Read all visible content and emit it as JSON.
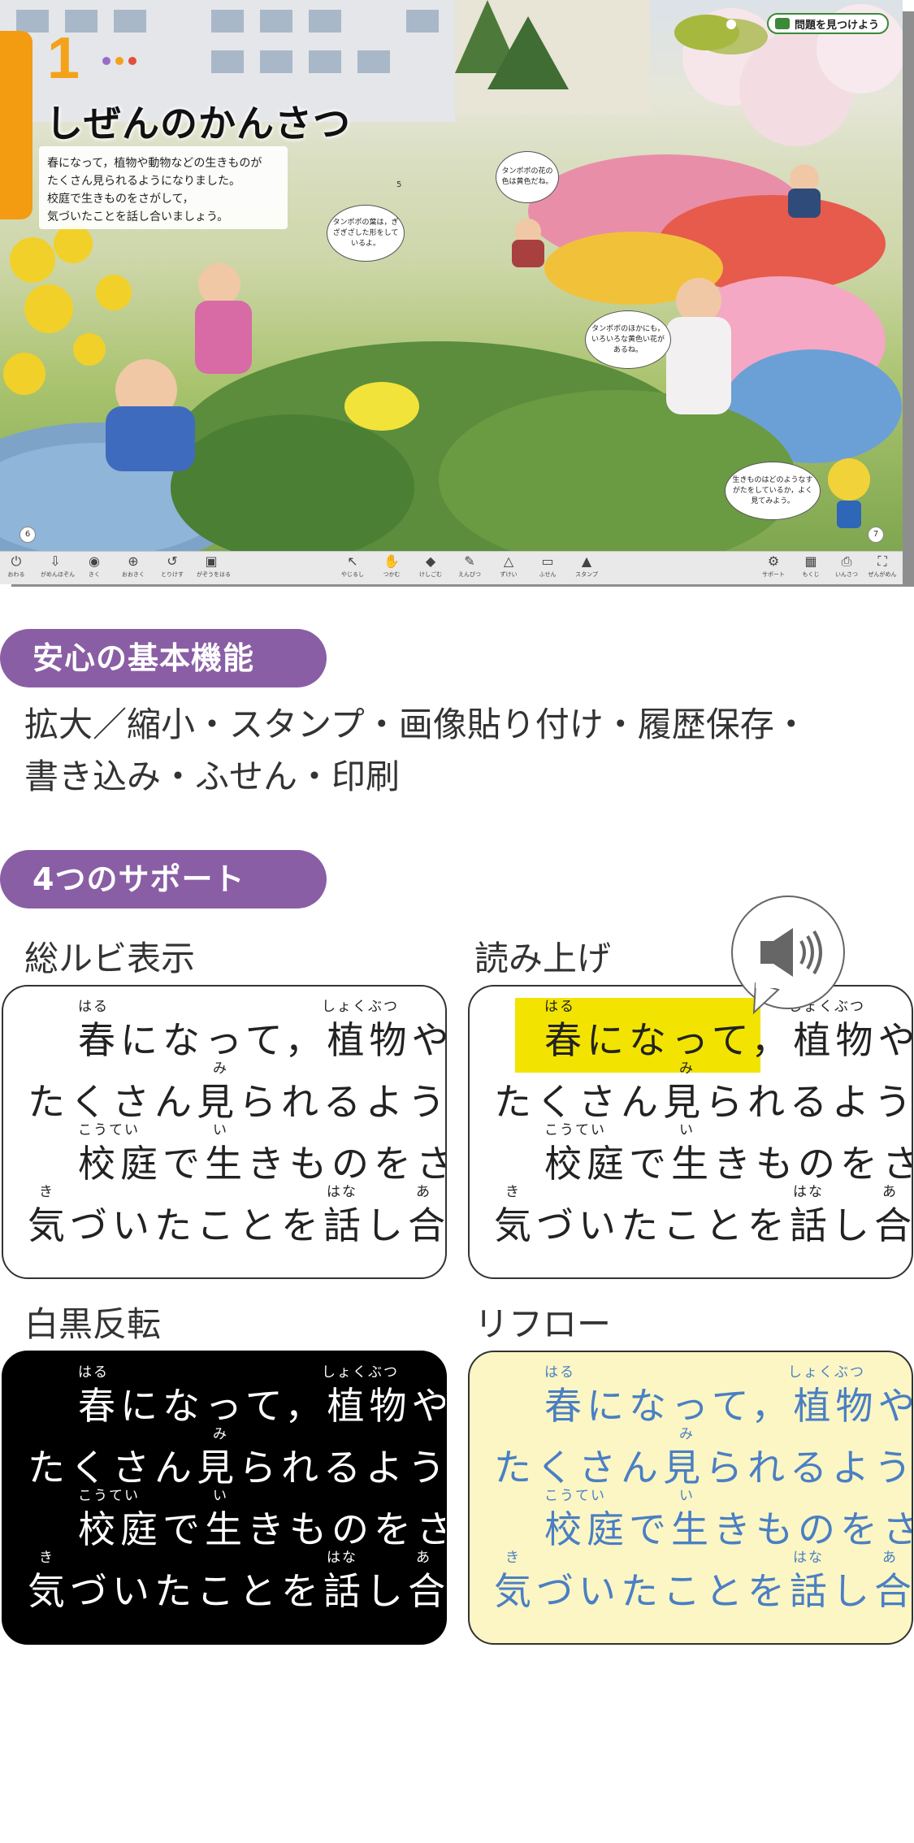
{
  "viewer": {
    "lesson_number": "1",
    "lesson_title": "しぜんのかんさつ",
    "intro_lines": [
      "春になって，植物や動物などの生きものが",
      "たくさん見られるようになりました。",
      "校庭で生きものをさがして，",
      "気づいたことを話し合いましょう。"
    ],
    "problem_badge": "問題を見つけよう",
    "bubbles": [
      "タンポポの葉は，ぎざぎざした形をしているよ。",
      "タンポポの花の色は黄色だね。",
      "タンポポのほかにも，いろいろな黄色い花があるね。",
      "生きものはどのようなすがたをしているか，よく見てみよう。"
    ],
    "page_left": "6",
    "page_right": "7",
    "page_mid": "5",
    "toolbar_left": [
      {
        "icon": "power-icon",
        "glyph": "⏻",
        "label": "おわる"
      },
      {
        "icon": "open-page-icon",
        "glyph": "⇩",
        "label": "がめんほぞん"
      },
      {
        "icon": "audio-icon",
        "glyph": "◉",
        "label": "きく"
      },
      {
        "icon": "zoom-in-icon",
        "glyph": "⊕",
        "label": "おおきく"
      },
      {
        "icon": "undo-icon",
        "glyph": "↺",
        "label": "とりけす"
      },
      {
        "icon": "image-icon",
        "glyph": "▣",
        "label": "がぞうをはる"
      }
    ],
    "toolbar_mid": [
      {
        "icon": "arrow-icon",
        "glyph": "↖",
        "label": "やじるし"
      },
      {
        "icon": "hand-icon",
        "glyph": "✋",
        "label": "つかむ"
      },
      {
        "icon": "eraser-icon",
        "glyph": "◆",
        "label": "けしごむ"
      },
      {
        "icon": "pen-icon",
        "glyph": "✎",
        "label": "えんぴつ"
      },
      {
        "icon": "shapes-icon",
        "glyph": "△",
        "label": "ずけい"
      },
      {
        "icon": "sticky-note-icon",
        "glyph": "▭",
        "label": "ふせん"
      },
      {
        "icon": "stamp-icon",
        "glyph": "▲",
        "label": "スタンプ"
      }
    ],
    "toolbar_right": [
      {
        "icon": "gear-icon",
        "glyph": "⚙",
        "label": "サポート"
      },
      {
        "icon": "grid-icon",
        "glyph": "▦",
        "label": "もくじ"
      },
      {
        "icon": "print-icon",
        "glyph": "⎙",
        "label": "いんさつ"
      },
      {
        "icon": "fullscreen-icon",
        "glyph": "⛶",
        "label": "ぜんがめん"
      }
    ]
  },
  "sections": {
    "basic": {
      "title": "安心の基本機能",
      "features_line1": "拡大／縮小・スタンプ・画像貼り付け・履歴保存・",
      "features_line2": "書き込み・ふせん・印刷"
    },
    "support": {
      "title": "4つのサポート",
      "labels": {
        "ruby": "総ルビ表示",
        "read_aloud": "読み上げ",
        "inverse": "白黒反転",
        "reflow": "リフロー"
      }
    }
  },
  "sample_text": {
    "line1": "春になって，植物や",
    "line2": "たくさん見られるよう",
    "line3": "校庭で生きものをさ",
    "line4": "気づいたことを話し合",
    "ruby": {
      "haru": "はる",
      "shokubutsu": "しょくぶつ",
      "mi": "み",
      "koutei": "こうてい",
      "i": "い",
      "ki": "き",
      "hana": "はな",
      "a": "あ"
    }
  },
  "colors": {
    "accent_orange": "#f39c12",
    "pill_purple": "#8a5ea5",
    "highlight_yellow": "#f2e400",
    "reflow_bg": "#fbf6c4",
    "reflow_text": "#4a7fc4",
    "inverse_bg": "#000000"
  }
}
